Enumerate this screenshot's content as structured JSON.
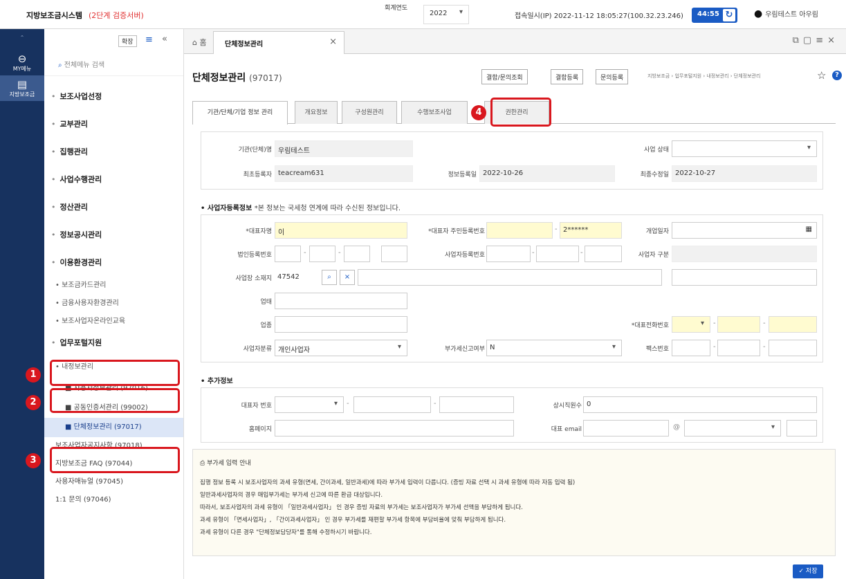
{
  "topbar": {
    "system_name": "지방보조금시스템",
    "server_label": "(2단계 검증서버)",
    "fiscal_year_label": "회계연도",
    "fiscal_year_value": "2022",
    "access_info": "접속일시(IP) 2022-11-12 18:05:27(100.32.23.246)",
    "session_timer": "44:55",
    "user_name": "우림테스트 아우림"
  },
  "leftnav": {
    "items": [
      {
        "label": "MY메뉴",
        "icon": "user-icon"
      },
      {
        "label": "지방보조금",
        "icon": "folder-icon"
      }
    ]
  },
  "sidebar": {
    "expand_label": "확장",
    "search_placeholder": "전체메뉴 검색",
    "menu": [
      "보조사업선정",
      "교부관리",
      "집행관리",
      "사업수행관리",
      "정산관리",
      "정보공시관리",
      "이용환경관리"
    ],
    "submenu": [
      "보조금카드관리",
      "금융사용자환경관리",
      "보조사업자온라인교육"
    ],
    "portal": "업무포털지원",
    "myinfo": "내정보관리",
    "myinfo_items": [
      "사용자정보관리 (97016)",
      "공동인증서관리 (99002)",
      "단체정보관리 (97017)"
    ],
    "other_items": [
      "보조사업자공지사항 (97018)",
      "지방보조금 FAQ (97044)",
      "사용자매뉴얼 (97045)",
      "1:1 문의 (97046)"
    ]
  },
  "callouts": [
    "1",
    "2",
    "3",
    "4"
  ],
  "main": {
    "tab_label": "단체정보관리",
    "page_title": "단체정보관리",
    "page_code": "(97017)",
    "buttons": [
      "결함/문의조회",
      "결함등록",
      "문의등록"
    ],
    "breadcrumb": "지방보조금 › 업무포털지원 › 내정보관리 › 단체정보관리",
    "subtabs": [
      "기관/단체/기업 정보 관리",
      "개요정보",
      "구성원관리",
      "수행보조사업",
      "권한관리"
    ],
    "basic": {
      "org_name_label": "기관(단체)명",
      "org_name_value": "우림테스트",
      "status_label": "사업 상태",
      "reg_user_label": "최초등록자",
      "reg_user_value": "teacream631",
      "reg_date_label": "정보등록일",
      "reg_date_value": "2022-10-26",
      "mod_date_label": "최종수정일",
      "mod_date_value": "2022-10-27"
    },
    "biz_section_title": "사업자등록정보",
    "biz_section_note": "*본 정보는 국세청 연계에 따라 수신된 정보입니다.",
    "biz": {
      "ceo_label": "*대표자명",
      "ceo_value": "이",
      "ceo_rrn_label": "*대표자 주민등록번호",
      "ceo_rrn_masked": "2******",
      "open_date_label": "개업일자",
      "corp_no_label": "법인등록번호",
      "biz_no_label": "사업자등록번호",
      "biz_type_label": "사업자 구분",
      "address_label": "사업장 소재지",
      "zip_value": "47542",
      "industry_label": "업태",
      "category_label": "업종",
      "phone_label": "*대표전화번호",
      "biz_class_label": "사업자분류",
      "biz_class_value": "개인사업자",
      "vat_label": "부가세신고여부",
      "vat_value": "N",
      "fax_label": "팩스번호"
    },
    "extra_section_title": "추가정보",
    "extra": {
      "rep_phone_label": "대표자 번호",
      "staff_label": "상시직원수",
      "staff_value": "0",
      "homepage_label": "홈페이지",
      "email_label": "대표 email",
      "at": "@"
    },
    "guide": {
      "title": "부가세 입력 안내",
      "lines": [
        "집행 정보 등록 시 보조사업자의 과세 유형(면세, 간이과세, 일반과세)에 따라 부가세 입력이 다릅니다. (증빙 자료 선택 시 과세 유형에 따라 자동 입력 됨)",
        "일반과세사업자의 경우 매입부가세는 부가세 신고에 따른 환급 대상입니다.",
        "따라서, 보조사업자의 과세 유형이 「일반과세사업자」 인 경우 증빙 자료의 부가세는 보조사업자가 부가세 선액을 부담하게 됩니다.",
        "과세 유형이 「면세사업자」, 「간이과세사업자」 인 경우 부가세를 재편할 부가세 항목에 부담비율에 맞춰 부담하게 됩니다.",
        "과세 유형이 다른 경우 \"단체정보담당자\"를 통해 수정하시기 바랍니다."
      ]
    },
    "save_label": "저장"
  }
}
